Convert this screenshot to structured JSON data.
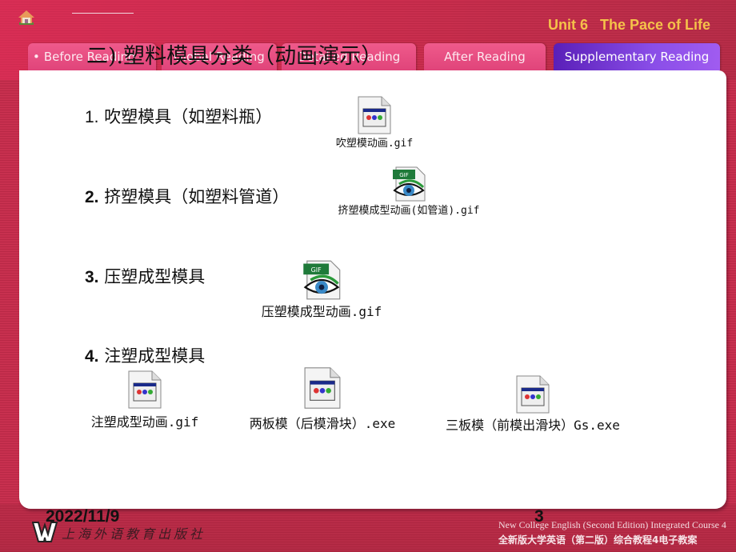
{
  "header": {
    "home_icon": "home-icon",
    "unit_title": "Unit 6   The Pace of Life"
  },
  "tabs": [
    {
      "label": "Before Reading",
      "bullet": "•",
      "active": false
    },
    {
      "label": "Global Reading",
      "active": false
    },
    {
      "label": "Detailed Reading",
      "active": false
    },
    {
      "label": "After Reading",
      "active": false
    },
    {
      "label": "Supplementary Reading",
      "active": true
    }
  ],
  "slide": {
    "title": "二).塑料模具分类（动画演示）",
    "items": [
      {
        "number": "1.",
        "text": "吹塑模具（如塑料瓶）"
      },
      {
        "number": "2.",
        "text": "挤塑模具（如塑料管道）"
      },
      {
        "number": "3.",
        "text": "压塑成型模具"
      },
      {
        "number": "4.",
        "text": "注塑成型模具"
      }
    ],
    "files": [
      {
        "name": "吹塑模动画.gif",
        "icon": "app-file-icon"
      },
      {
        "name": "挤塑模成型动画(如管道).gif",
        "icon": "gif-eye-icon"
      },
      {
        "name": "压塑模成型动画.gif",
        "icon": "gif-eye-icon"
      },
      {
        "name": "注塑成型动画.gif",
        "icon": "app-file-icon"
      },
      {
        "name": "两板模（后模滑块）.exe",
        "icon": "app-file-icon"
      },
      {
        "name": "三板模（前模出滑块）Gs.exe",
        "icon": "app-file-icon"
      }
    ]
  },
  "footer": {
    "date": "2022/11/9",
    "page_number": "3",
    "publisher": "上海外语教育出版社",
    "course_en": "New College English (Second Edition) Integrated Course 4",
    "course_cn": "全新版大学英语（第二版）综合教程4电子教案"
  }
}
